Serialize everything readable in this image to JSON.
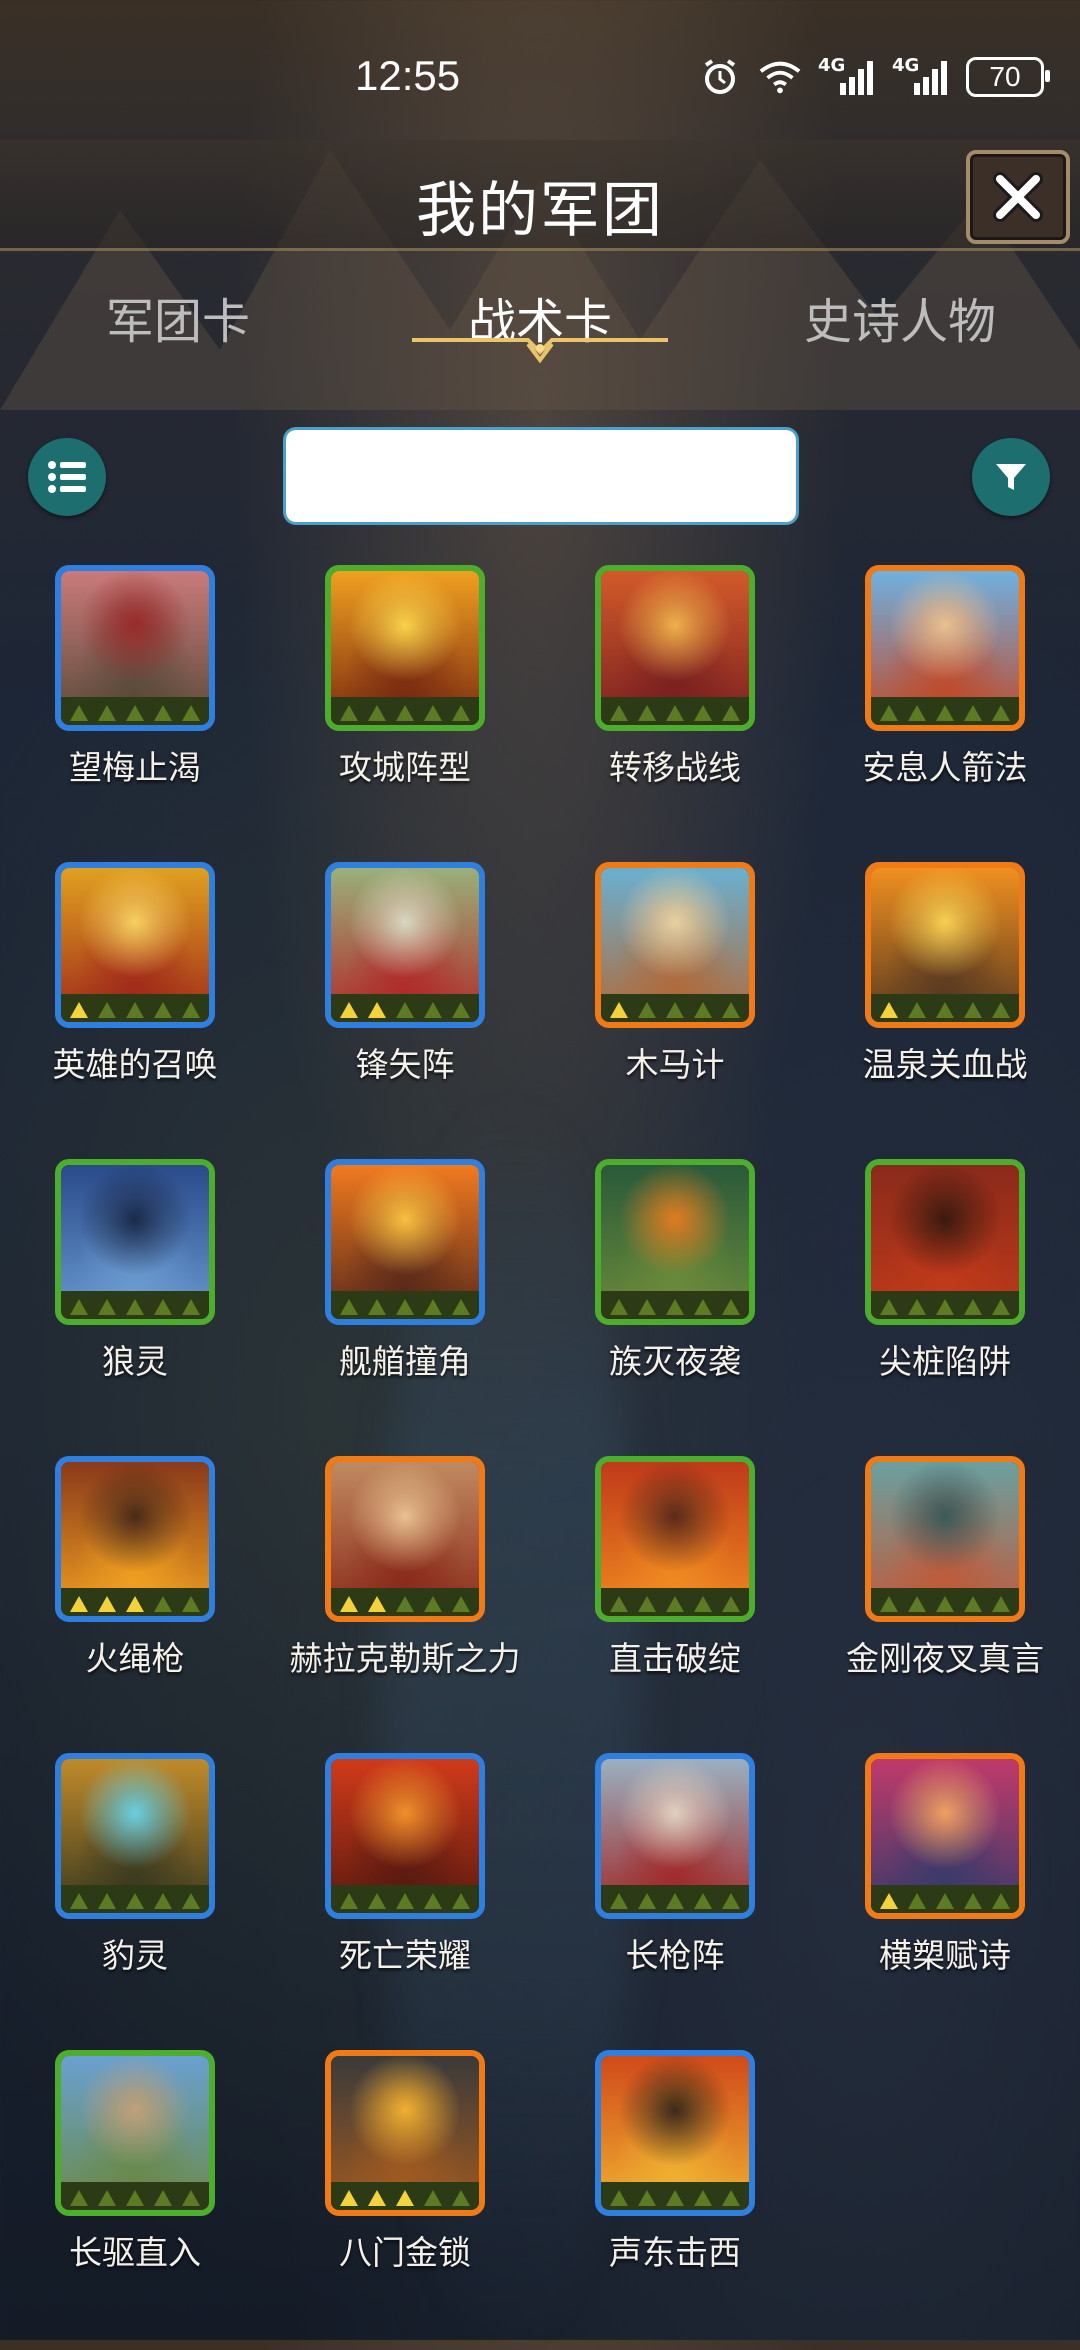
{
  "status_bar": {
    "time": "12:55",
    "signal_1_label": "4G",
    "signal_2_label": "4G",
    "battery": "70"
  },
  "header": {
    "title": "我的军团",
    "close_icon": "close-icon"
  },
  "tabs": [
    {
      "label": "军团卡",
      "active": false
    },
    {
      "label": "战术卡",
      "active": true
    },
    {
      "label": "史诗人物",
      "active": false
    }
  ],
  "search": {
    "value": "",
    "placeholder": ""
  },
  "cards": [
    {
      "name": "望梅止渴",
      "rarity": "blue",
      "crowns_gold": 0,
      "palette": [
        "#c97a7a",
        "#5a4a3a",
        "#9a2a2a"
      ]
    },
    {
      "name": "攻城阵型",
      "rarity": "green",
      "crowns_gold": 0,
      "palette": [
        "#f0a020",
        "#7a2a10",
        "#f9d24a"
      ]
    },
    {
      "name": "转移战线",
      "rarity": "green",
      "crowns_gold": 0,
      "palette": [
        "#d25a2a",
        "#7a2020",
        "#f0b04a"
      ]
    },
    {
      "name": "安息人箭法",
      "rarity": "orange",
      "crowns_gold": 0,
      "palette": [
        "#6fb0e0",
        "#c04a2a",
        "#e8c090"
      ]
    },
    {
      "name": "英雄的召唤",
      "rarity": "blue",
      "crowns_gold": 1,
      "palette": [
        "#e0a020",
        "#a02a1a",
        "#f7d060"
      ]
    },
    {
      "name": "锋矢阵",
      "rarity": "blue",
      "crowns_gold": 2,
      "palette": [
        "#9ab07a",
        "#b02a2a",
        "#d8d8c0"
      ]
    },
    {
      "name": "木马计",
      "rarity": "orange",
      "crowns_gold": 1,
      "palette": [
        "#6ab0d0",
        "#b06a3a",
        "#e8d0a0"
      ]
    },
    {
      "name": "温泉关血战",
      "rarity": "orange",
      "crowns_gold": 1,
      "palette": [
        "#f09020",
        "#5a3a20",
        "#f8d050"
      ]
    },
    {
      "name": "狼灵",
      "rarity": "green",
      "crowns_gold": 0,
      "palette": [
        "#2a4a8a",
        "#6a9ad0",
        "#1a2a4a"
      ]
    },
    {
      "name": "舰艏撞角",
      "rarity": "blue",
      "crowns_gold": 0,
      "palette": [
        "#f07a20",
        "#5a2a1a",
        "#f8c040"
      ]
    },
    {
      "name": "族灭夜袭",
      "rarity": "green",
      "crowns_gold": 0,
      "palette": [
        "#2a5a3a",
        "#6a8a3a",
        "#e07a20"
      ]
    },
    {
      "name": "尖桩陷阱",
      "rarity": "green",
      "crowns_gold": 0,
      "palette": [
        "#8a2a1a",
        "#c03a1a",
        "#3a1a10"
      ]
    },
    {
      "name": "火绳枪",
      "rarity": "blue",
      "crowns_gold": 3,
      "palette": [
        "#8a3a1a",
        "#f0a020",
        "#4a2a1a"
      ]
    },
    {
      "name": "赫拉克勒斯之力",
      "rarity": "orange",
      "crowns_gold": 2,
      "palette": [
        "#c08a60",
        "#8a2a1a",
        "#e8c090"
      ]
    },
    {
      "name": "直击破绽",
      "rarity": "green",
      "crowns_gold": 0,
      "palette": [
        "#c03a1a",
        "#f08a20",
        "#5a2a1a"
      ]
    },
    {
      "name": "金刚夜叉真言",
      "rarity": "orange",
      "crowns_gold": 0,
      "palette": [
        "#6aa0a0",
        "#c05a3a",
        "#3a5a5a"
      ]
    },
    {
      "name": "豹灵",
      "rarity": "blue",
      "crowns_gold": 0,
      "palette": [
        "#c08a2a",
        "#3a3a20",
        "#6ad0e0"
      ]
    },
    {
      "name": "死亡荣耀",
      "rarity": "blue",
      "crowns_gold": 0,
      "palette": [
        "#d03a1a",
        "#5a1a10",
        "#f0902a"
      ]
    },
    {
      "name": "长枪阵",
      "rarity": "blue",
      "crowns_gold": 0,
      "palette": [
        "#9ab0c0",
        "#a02a2a",
        "#e0d0c0"
      ]
    },
    {
      "name": "横槊赋诗",
      "rarity": "orange",
      "crowns_gold": 1,
      "palette": [
        "#c03a6a",
        "#3a3a6a",
        "#f0a060"
      ]
    },
    {
      "name": "长驱直入",
      "rarity": "green",
      "crowns_gold": 0,
      "palette": [
        "#6aa0d0",
        "#6a8a4a",
        "#c0a07a"
      ]
    },
    {
      "name": "八门金锁",
      "rarity": "orange",
      "crowns_gold": 3,
      "palette": [
        "#3a3a3a",
        "#a05a20",
        "#f0b030"
      ]
    },
    {
      "name": "声东击西",
      "rarity": "blue",
      "crowns_gold": 0,
      "palette": [
        "#d04a1a",
        "#f0b030",
        "#3a2a1a"
      ]
    }
  ]
}
